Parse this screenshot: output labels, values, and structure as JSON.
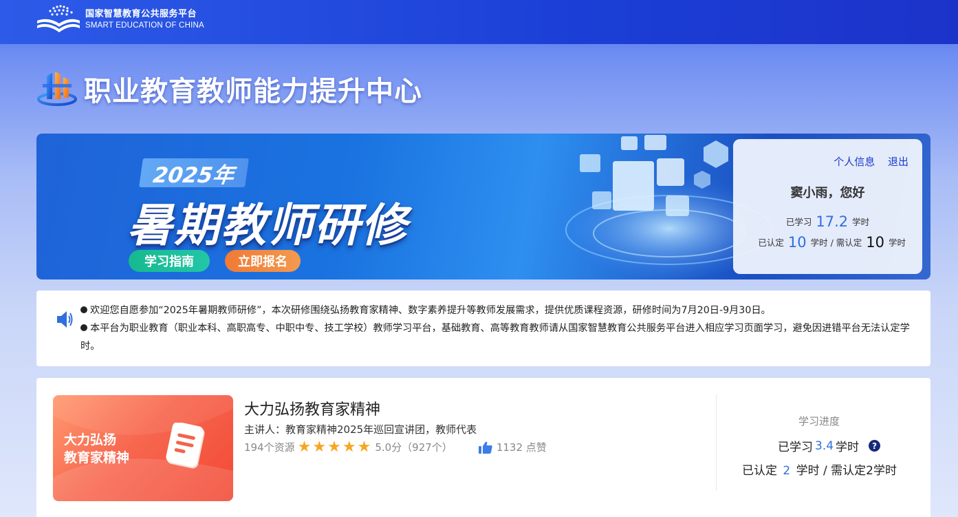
{
  "header": {
    "logo_cn": "国家智慧教育公共服务平台",
    "logo_en": "SMART EDUCATION OF CHINA"
  },
  "hero": {
    "title": "职业教育教师能力提升中心"
  },
  "banner": {
    "year": "2025年",
    "main_title": "暑期教师研修",
    "guide_button": "学习指南",
    "enroll_button": "立即报名"
  },
  "user": {
    "profile_link": "个人信息",
    "logout_link": "退出",
    "greeting": "窦小雨，您好",
    "studied_prefix": "已学习",
    "studied_hours": "17.2",
    "hours_unit": "学时",
    "certified_prefix": "已认定",
    "certified_hours": "10",
    "required_sep": "学时 / 需认定",
    "required_hours": "10",
    "required_unit": "学时"
  },
  "notice": {
    "lines": [
      "欢迎您自愿参加“2025年暑期教师研修”，本次研修围绕弘扬教育家精神、数字素养提升等教师发展需求，提供优质课程资源，研修时间为7月20日-9月30日。",
      "本平台为职业教育（职业本科、高职高专、中职中专、技工学校）教师学习平台，基础教育、高等教育教师请从国家智慧教育公共服务平台进入相应学习页面学习，避免因进错平台无法认定学时。"
    ]
  },
  "course": {
    "thumb_line1": "大力弘扬",
    "thumb_line2": "教育家精神",
    "title": "大力弘扬教育家精神",
    "speaker": "主讲人：教育家精神2025年巡回宣讲团，教师代表",
    "resources": "194个资源",
    "rating": 5,
    "rating_text": "5.0分（927个）",
    "likes": "1132 点赞",
    "progress_label": "学习进度",
    "studied_prefix": "已学习",
    "studied_hours": "3.4",
    "studied_unit": "学时",
    "certified_prefix": "已认定",
    "certified_hours": "2",
    "certified_suffix": "学时 / 需认定2学时"
  },
  "colors": {
    "accent_blue": "#2f6fe0",
    "link_blue": "#1a3ac8",
    "star": "#f5a623",
    "guide_green": "#16b98f",
    "enroll_orange": "#f07a35"
  }
}
